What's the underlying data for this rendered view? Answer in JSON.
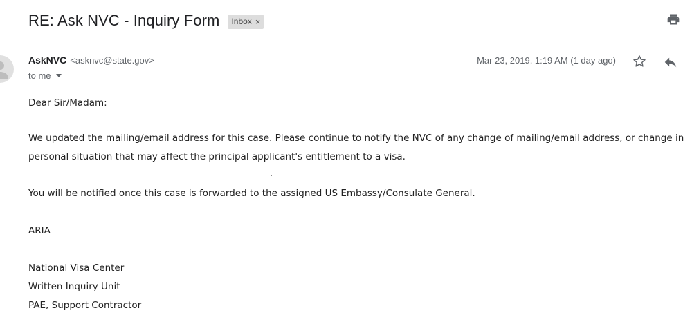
{
  "email": {
    "subject": "RE: Ask NVC - Inquiry Form",
    "label_chip": {
      "text": "Inbox",
      "remove_glyph": "×"
    },
    "sender": {
      "name": "AskNVC",
      "email": "<asknvc@state.gov>"
    },
    "recipient_text": "to me",
    "date": "Mar 23, 2019, 1:19 AM (1 day ago)",
    "body": {
      "greeting": "Dear Sir/Madam:",
      "paragraph1_line1": "We updated the mailing/email address for this case.  Please continue to notify the NVC of any change of mailing/email address, or change in",
      "paragraph1_line2": "personal situation that may affect the principal applicant's entitlement to a visa.",
      "stray_mark": ".",
      "paragraph2": "You will be notified once this case is forwarded to the assigned US Embassy/Consulate General.",
      "signature_name": "ARIA",
      "signature_lines": [
        "National Visa Center",
        "Written Inquiry Unit",
        "PAE, Support Contractor"
      ]
    }
  },
  "icons": {
    "print": "print-icon",
    "star": "star-icon",
    "reply": "reply-icon",
    "avatar": "person-icon",
    "recipient_caret": "caret-down-icon",
    "label_remove": "close-icon"
  },
  "colors": {
    "text_primary": "#202124",
    "text_secondary": "#5f6368",
    "chip_background": "#dddddd",
    "icon_gray": "#5f6368"
  }
}
